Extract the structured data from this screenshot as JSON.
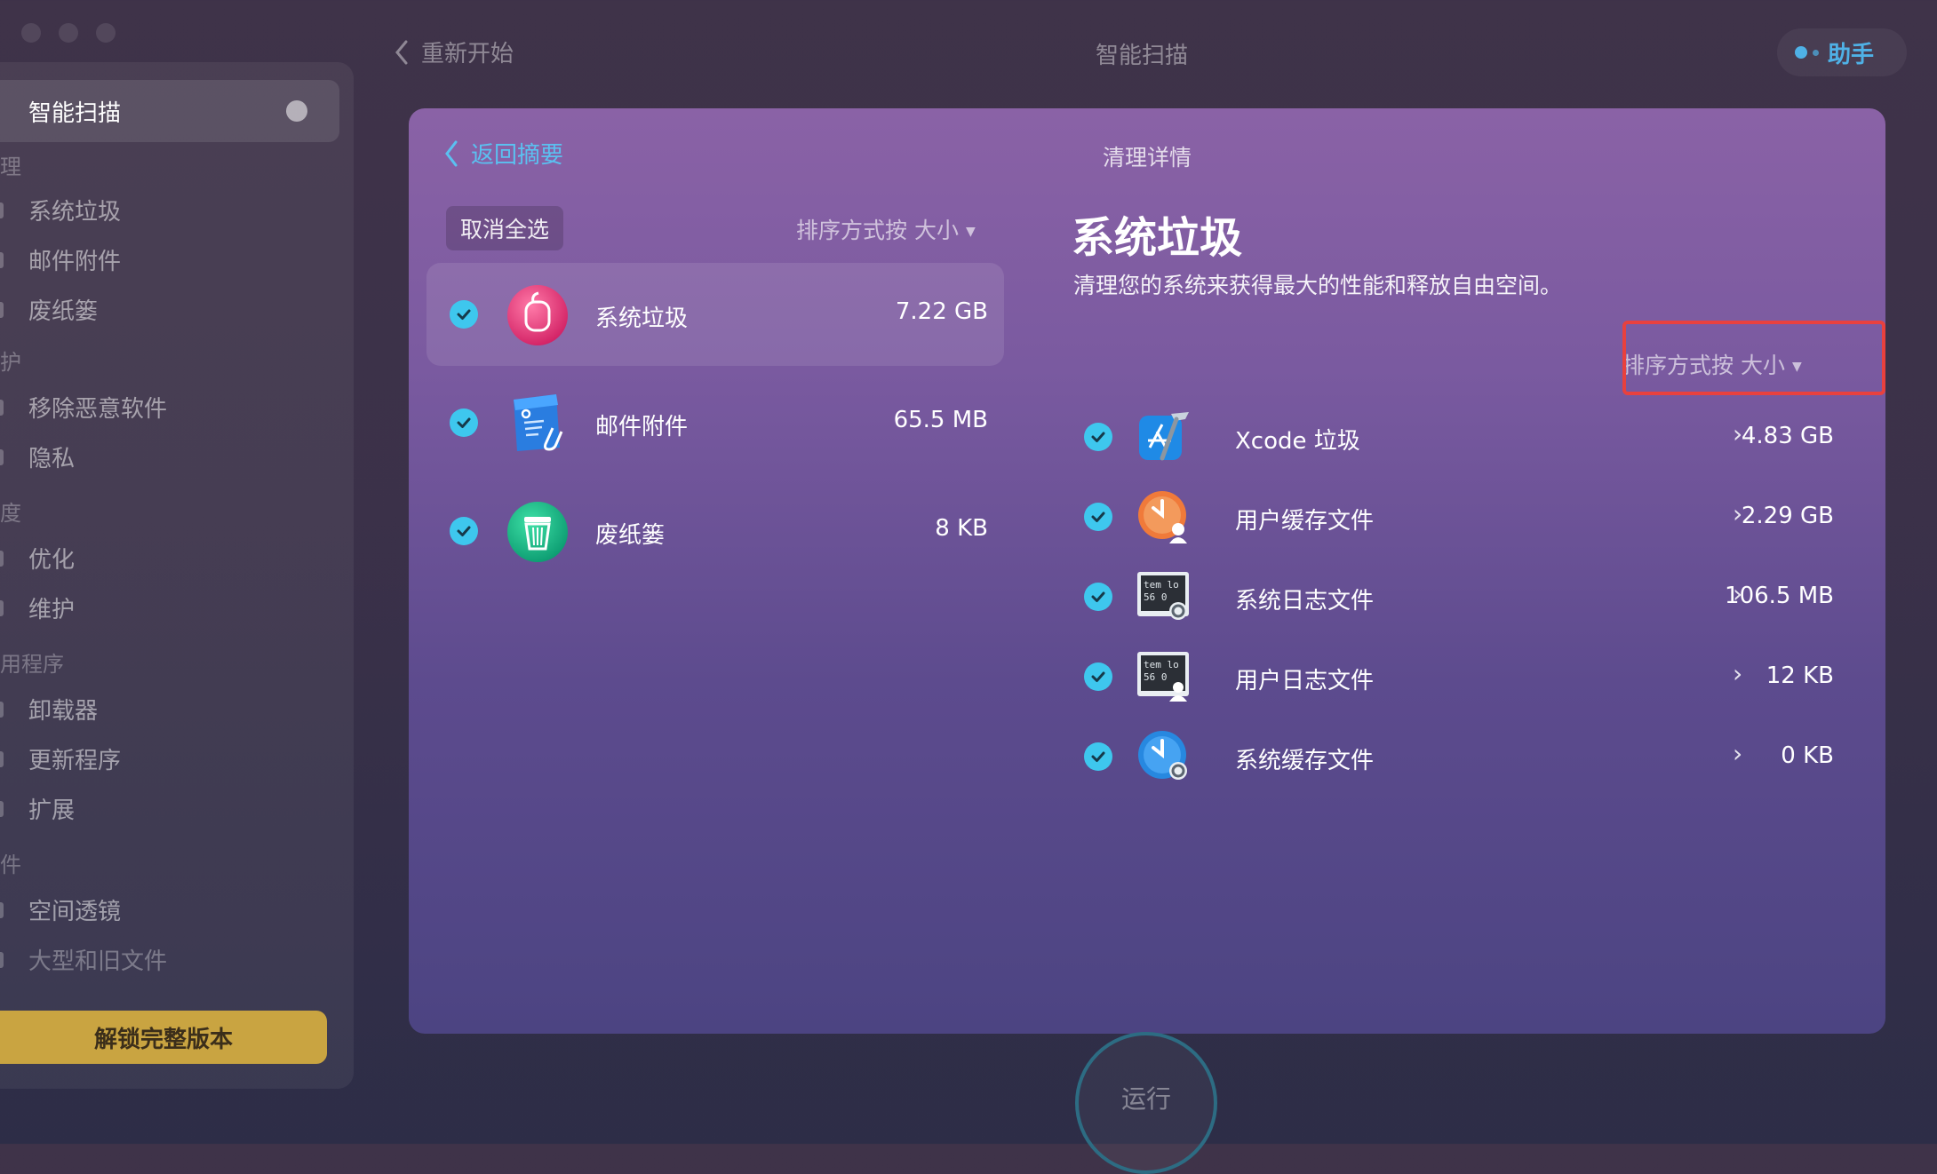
{
  "window": {
    "back_label": "重新开始",
    "title": "智能扫描",
    "assistant_label": "助手"
  },
  "sidebar": {
    "active_item": "智能扫描",
    "sections": [
      {
        "header": "理",
        "items": [
          "系统垃圾",
          "邮件附件",
          "废纸篓"
        ]
      },
      {
        "header": "护",
        "items": [
          "移除恶意软件",
          "隐私"
        ]
      },
      {
        "header": "度",
        "items": [
          "优化",
          "维护"
        ]
      },
      {
        "header": "用程序",
        "items": [
          "卸载器",
          "更新程序",
          "扩展"
        ]
      },
      {
        "header": "件",
        "items": [
          "空间透镜",
          "大型和旧文件"
        ]
      }
    ],
    "unlock_label": "解锁完整版本"
  },
  "panel": {
    "back_label": "返回摘要",
    "title": "清理详情",
    "deselect_label": "取消全选",
    "sort_label": "排序方式按 大小",
    "categories": [
      {
        "name": "系统垃圾",
        "size": "7.22 GB",
        "checked": true,
        "icon": "system-junk-icon"
      },
      {
        "name": "邮件附件",
        "size": "65.5 MB",
        "checked": true,
        "icon": "mail-attachments-icon"
      },
      {
        "name": "废纸篓",
        "size": "8 KB",
        "checked": true,
        "icon": "trash-icon"
      }
    ],
    "detail": {
      "title": "系统垃圾",
      "subtitle": "清理您的系统来获得最大的性能和释放自由空间。",
      "sort_label": "排序方式按 大小",
      "items": [
        {
          "name": "Xcode 垃圾",
          "size": "4.83 GB",
          "icon": "xcode-icon"
        },
        {
          "name": "用户缓存文件",
          "size": "2.29 GB",
          "icon": "user-cache-icon"
        },
        {
          "name": "系统日志文件",
          "size": "106.5 MB",
          "icon": "system-log-icon"
        },
        {
          "name": "用户日志文件",
          "size": "12 KB",
          "icon": "user-log-icon"
        },
        {
          "name": "系统缓存文件",
          "size": "0 KB",
          "icon": "system-cache-icon"
        }
      ]
    },
    "log_icon_text": [
      "tem lo",
      "56 0"
    ]
  },
  "run_label": "运行",
  "colors": {
    "accent": "#3ec7ee",
    "link": "#5bc0f0",
    "highlight": "#e8413e",
    "unlock": "#c9a441"
  }
}
